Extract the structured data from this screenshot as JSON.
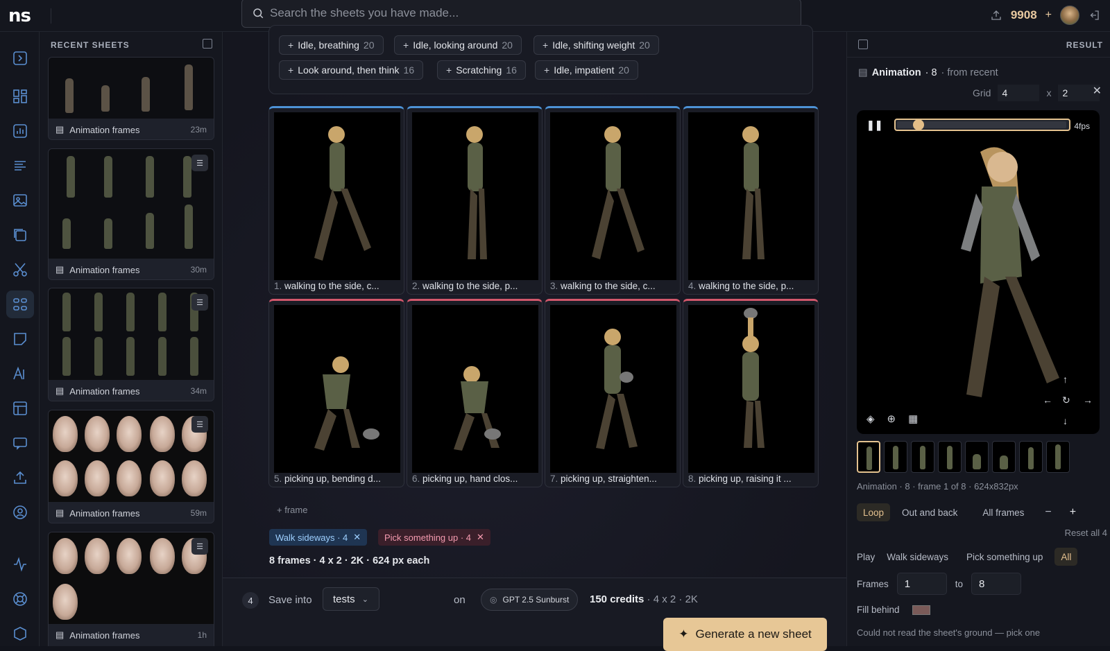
{
  "app": {
    "logo": "ns"
  },
  "search": {
    "placeholder": "Search the sheets you have made..."
  },
  "topbar": {
    "credits": "9908",
    "plus": "+"
  },
  "recent": {
    "heading": "RECENT SHEETS",
    "cards": [
      {
        "label": "Animation frames",
        "ago": "23m"
      },
      {
        "label": "Animation frames",
        "ago": "30m"
      },
      {
        "label": "Animation frames",
        "ago": "34m"
      },
      {
        "label": "Animation frames",
        "ago": "59m"
      },
      {
        "label": "Animation frames",
        "ago": "1h"
      }
    ]
  },
  "presets": [
    {
      "label": "Idle, breathing",
      "count": "20"
    },
    {
      "label": "Idle, looking around",
      "count": "20"
    },
    {
      "label": "Idle, shifting weight",
      "count": "20"
    },
    {
      "label": "Look around, then think",
      "count": "16"
    },
    {
      "label": "Scratching",
      "count": "16"
    },
    {
      "label": "Idle, impatient",
      "count": "20"
    }
  ],
  "frames": [
    {
      "num": "1.",
      "caption": "walking to the side, c...",
      "group": "blue"
    },
    {
      "num": "2.",
      "caption": "walking to the side, p...",
      "group": "blue"
    },
    {
      "num": "3.",
      "caption": "walking to the side, c...",
      "group": "blue"
    },
    {
      "num": "4.",
      "caption": "walking to the side, p...",
      "group": "blue"
    },
    {
      "num": "5.",
      "caption": "picking up, bending d...",
      "group": "red"
    },
    {
      "num": "6.",
      "caption": "picking up, hand clos...",
      "group": "red"
    },
    {
      "num": "7.",
      "caption": "picking up, straighten...",
      "group": "red"
    },
    {
      "num": "8.",
      "caption": "picking up, raising it ...",
      "group": "red"
    }
  ],
  "add_frame": "+ frame",
  "tags": {
    "walk": "Walk sideways · 4",
    "pick": "Pick something up · 4"
  },
  "summary": "8 frames · 4 x 2 · 2K · 624 px each",
  "bottom": {
    "step": "4",
    "save_into": "Save into",
    "folder": "tests",
    "on": "on",
    "model": "GPT 2.5 Sunburst",
    "credits_bold": "150 credits",
    "credits_rest": " · 4 x 2 · 2K",
    "generate": "Generate a new sheet"
  },
  "result": {
    "header": "RESULT",
    "title": "Animation",
    "title_count": "· 8",
    "title_src": "· from recent",
    "grid_label": "Grid",
    "grid_cols": "4",
    "grid_x": "x",
    "grid_rows": "2",
    "fps": "4fps",
    "progress": 0.1,
    "meta": "Animation · 8 · frame 1 of 8 · 624x832px",
    "modes": [
      "Loop",
      "Out and back",
      "All frames"
    ],
    "reset": "Reset all 4",
    "play_label": "Play",
    "play_opts": [
      "Walk sideways",
      "Pick something up",
      "All"
    ],
    "frames_label": "Frames",
    "from": "1",
    "to_label": "to",
    "to": "8",
    "fill_label": "Fill behind",
    "fill_color": "#7a5a58",
    "warning": "Could not read the sheet's ground — pick one"
  }
}
